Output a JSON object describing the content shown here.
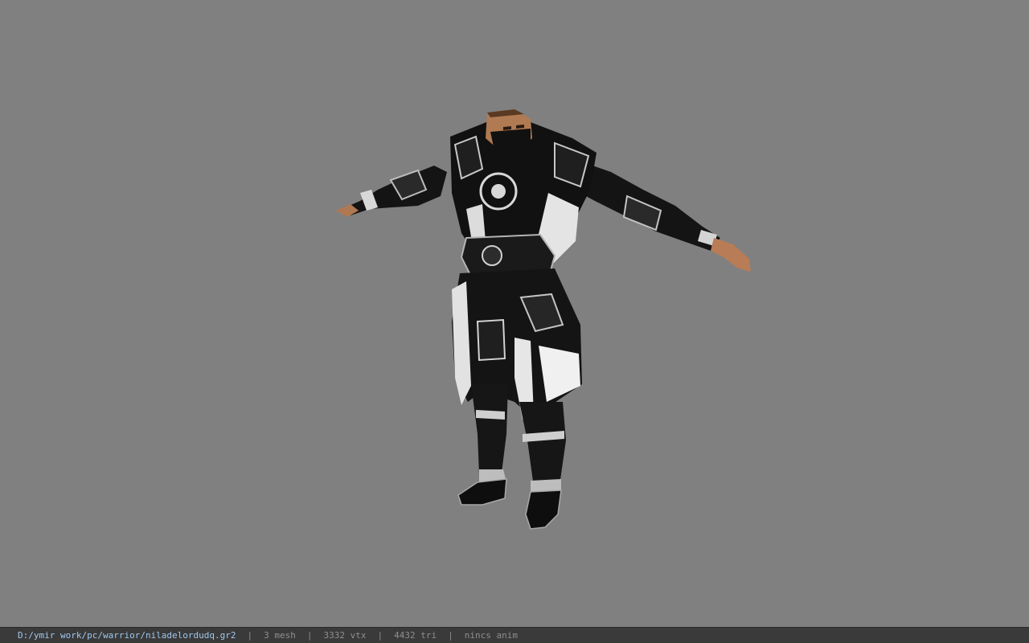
{
  "viewport": {
    "background_color": "#808080",
    "model_subject": "warrior-character-t-pose"
  },
  "status_bar": {
    "file_path": "D:/ymir work/pc/warrior/niladelordudq.gr2",
    "separator": "|",
    "mesh_count": "3 mesh",
    "vertex_count": "3332 vtx",
    "triangle_count": "4432 tri",
    "anim_status": "nincs anim",
    "path_color": "#9ec8f0",
    "text_color": "#8f8f8f"
  }
}
